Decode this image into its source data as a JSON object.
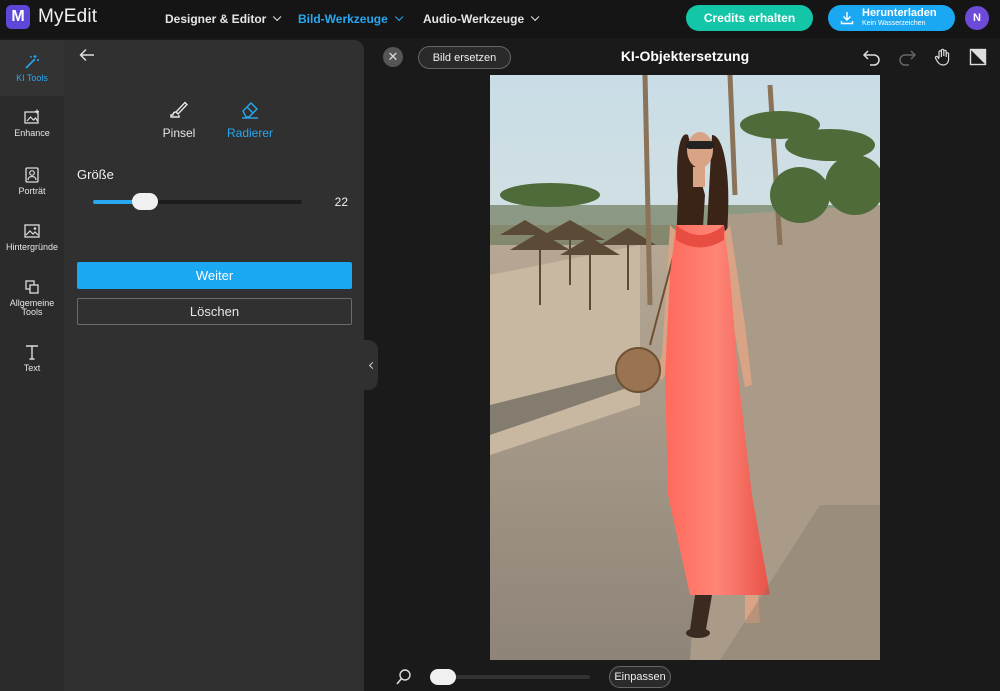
{
  "app": {
    "name": "MyEdit",
    "logo_letter": "M"
  },
  "nav": [
    {
      "label": "Designer & Editor",
      "active": false
    },
    {
      "label": "Bild-Werkzeuge",
      "active": true
    },
    {
      "label": "Audio-Werkzeuge",
      "active": false
    }
  ],
  "header": {
    "credits_label": "Credits erhalten",
    "download_label": "Herunterladen",
    "download_sublabel": "Kein Wasserzeichen",
    "avatar_initial": "N"
  },
  "sidebar": {
    "items": [
      {
        "label": "KI Tools",
        "icon": "magic-wand-icon",
        "active": true
      },
      {
        "label": "Enhance",
        "icon": "enhance-icon",
        "active": false
      },
      {
        "label": "Porträt",
        "icon": "portrait-icon",
        "active": false
      },
      {
        "label": "Hintergründe",
        "icon": "background-icon",
        "active": false
      },
      {
        "label": "Allgemeine Tools",
        "icon": "general-tools-icon",
        "active": false
      },
      {
        "label": "Text",
        "icon": "text-icon",
        "active": false
      }
    ]
  },
  "panel": {
    "tools": [
      {
        "label": "Pinsel",
        "icon": "brush-icon",
        "active": false
      },
      {
        "label": "Radierer",
        "icon": "eraser-icon",
        "active": true
      }
    ],
    "size_label": "Größe",
    "size_value": "22",
    "size_fraction": 0.21,
    "continue_label": "Weiter",
    "delete_label": "Löschen"
  },
  "canvas": {
    "replace_label": "Bild ersetzen",
    "title": "KI-Objektersetzung",
    "fit_label": "Einpassen",
    "zoom_fraction": 0.0
  },
  "colors": {
    "accent": "#1ba8f2",
    "credits": "#14c6a8",
    "brand": "#5b47d8"
  }
}
